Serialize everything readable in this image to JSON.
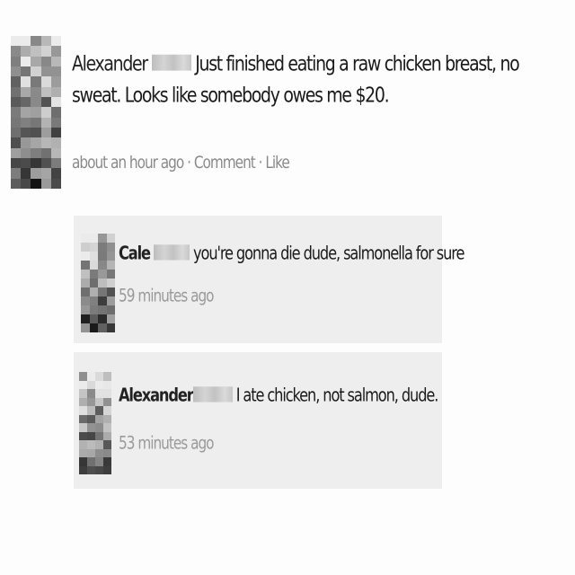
{
  "post": {
    "author": "Alexander",
    "text": "Just finished eating a raw chicken breast, no sweat. Looks like somebody owes me $20.",
    "timestamp": "about an hour ago",
    "separator": " · ",
    "comment_link": "Comment",
    "like_link": "Like"
  },
  "comments": [
    {
      "author": "Cale",
      "text": "you're gonna die dude, salmonella for sure",
      "timestamp": "59 minutes ago"
    },
    {
      "author": "Alexander",
      "text": "I ate chicken, not salmon, dude.",
      "timestamp": "53 minutes ago"
    }
  ]
}
